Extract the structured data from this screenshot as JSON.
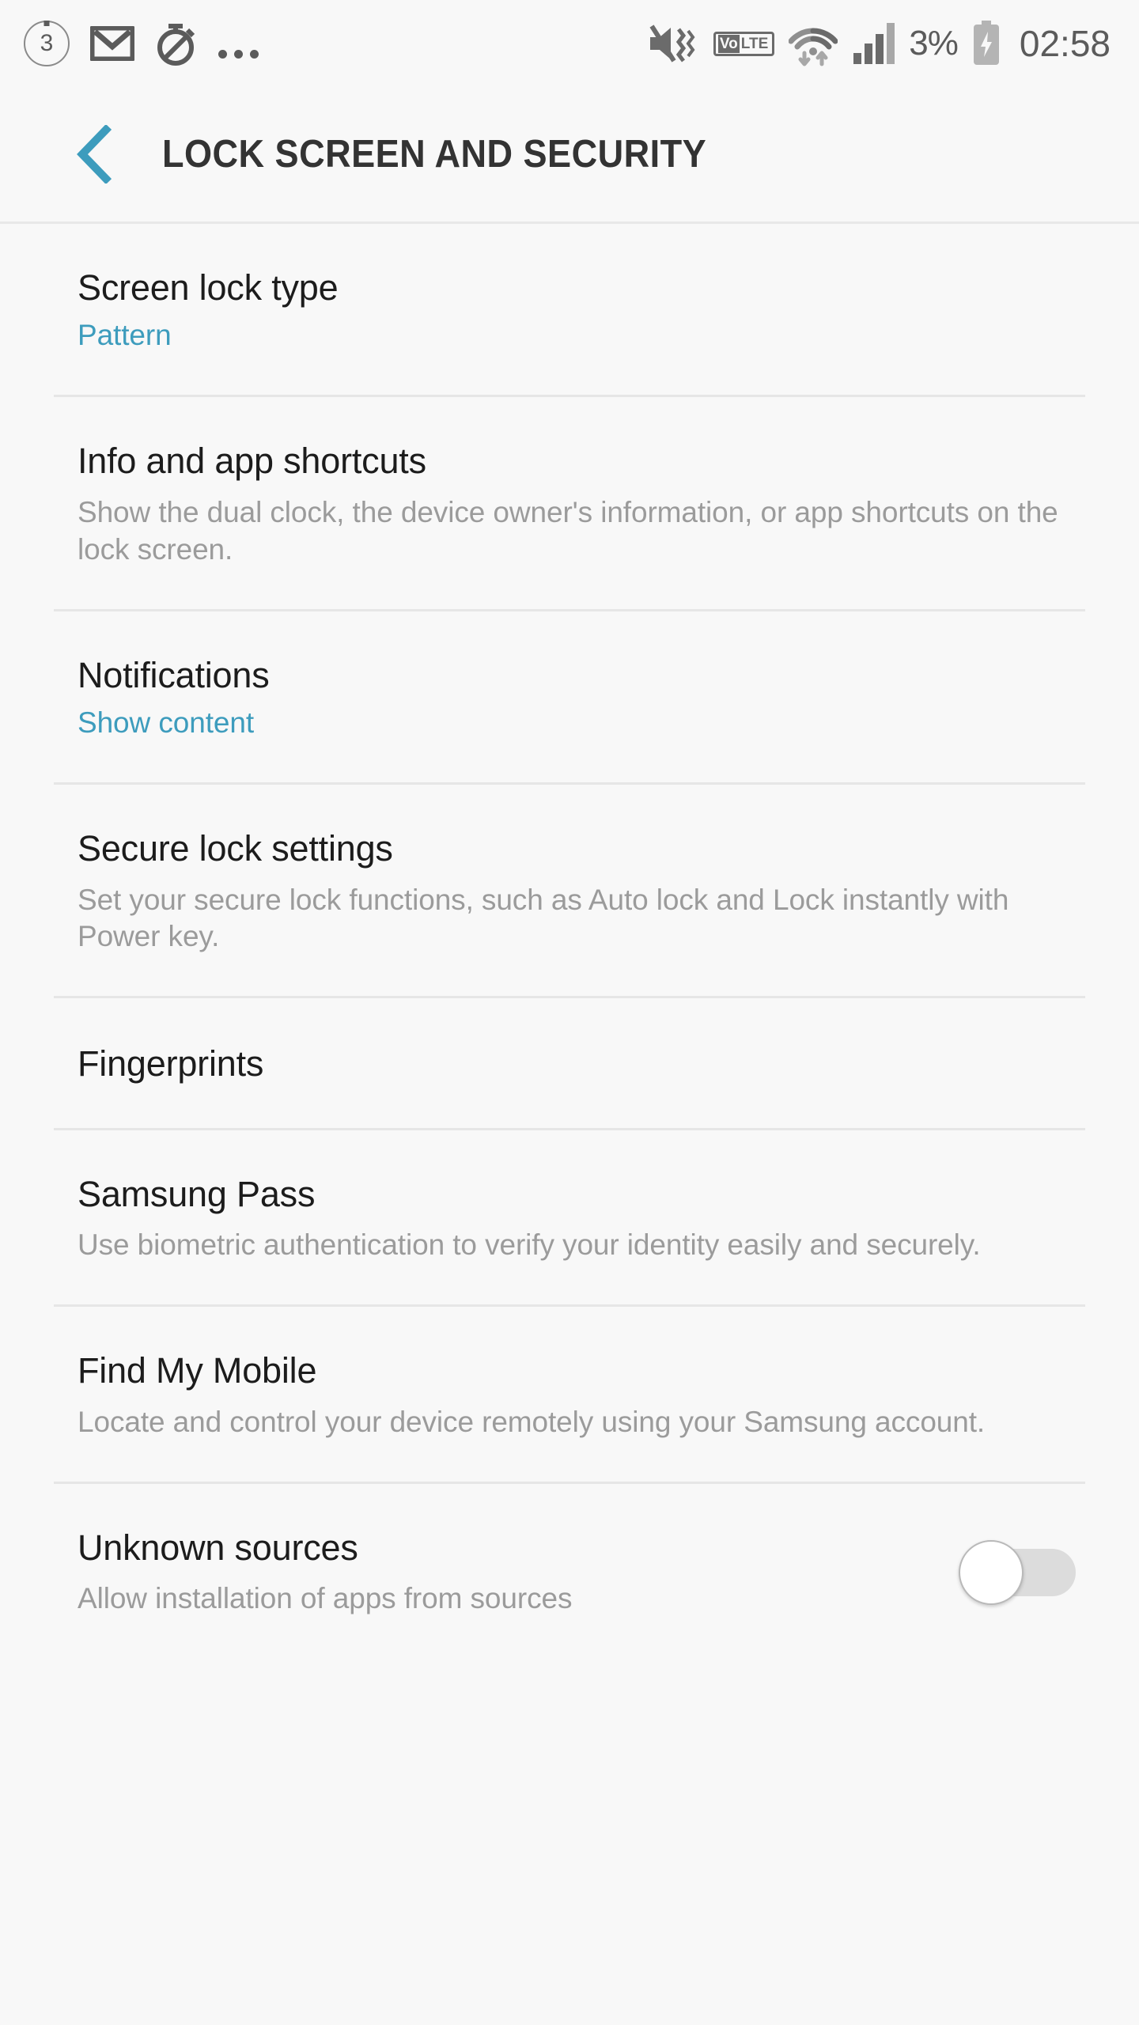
{
  "status_bar": {
    "notification_count": "3",
    "left_icons": [
      "notification-count-badge",
      "gmail-icon",
      "timer-off-icon",
      "more-notifications-icon"
    ],
    "right_icons": [
      "mute-vibrate-icon",
      "volte-icon",
      "wifi-data-icon",
      "signal-bars-icon",
      "charging-battery-icon"
    ],
    "volte_label_prefix": "Vo",
    "volte_label_suffix": "LTE",
    "battery_percent": "3%",
    "time": "02:58"
  },
  "header": {
    "title": "LOCK SCREEN AND SECURITY",
    "back_icon": "chevron-left-icon"
  },
  "colors": {
    "accent": "#3d9cbd",
    "background": "#f8f8f8",
    "title_text": "#1c1c1c",
    "subtitle_text": "#9b9b9b",
    "divider": "#e6e6e6"
  },
  "settings": [
    {
      "title": "Screen lock type",
      "subtitle": "Pattern",
      "subtitle_style": "accent",
      "has_toggle": false
    },
    {
      "title": "Info and app shortcuts",
      "subtitle": "Show the dual clock, the device owner's information, or app shortcuts on the lock screen.",
      "subtitle_style": "muted",
      "has_toggle": false
    },
    {
      "title": "Notifications",
      "subtitle": "Show content",
      "subtitle_style": "accent",
      "has_toggle": false
    },
    {
      "title": "Secure lock settings",
      "subtitle": "Set your secure lock functions, such as Auto lock and Lock instantly with Power key.",
      "subtitle_style": "muted",
      "has_toggle": false
    },
    {
      "title": "Fingerprints",
      "subtitle": "",
      "subtitle_style": "none",
      "has_toggle": false
    },
    {
      "title": "Samsung Pass",
      "subtitle": "Use biometric authentication to verify your identity easily and securely.",
      "subtitle_style": "muted",
      "has_toggle": false
    },
    {
      "title": "Find My Mobile",
      "subtitle": "Locate and control your device remotely using your Samsung account.",
      "subtitle_style": "muted",
      "has_toggle": false
    },
    {
      "title": "Unknown sources",
      "subtitle": "Allow installation of apps from sources",
      "subtitle_style": "muted",
      "has_toggle": true,
      "toggle_state": "off"
    }
  ]
}
